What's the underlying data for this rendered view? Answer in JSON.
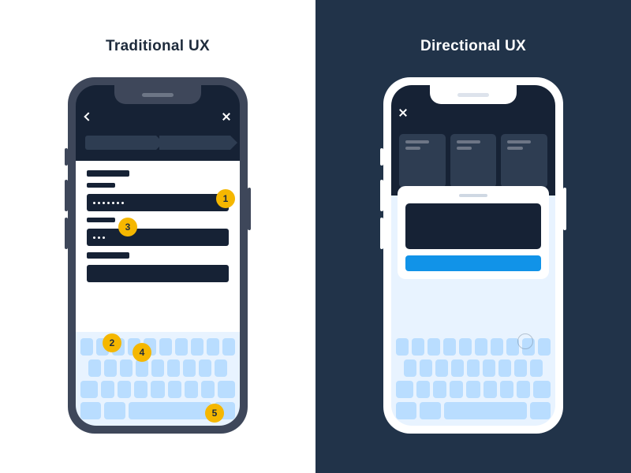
{
  "left": {
    "title": "Traditional UX"
  },
  "right": {
    "title": "Directional UX"
  },
  "badges": {
    "b1": "1",
    "b2": "2",
    "b3": "3",
    "b4": "4",
    "b5": "5"
  },
  "colors": {
    "dark_navy": "#162235",
    "slate": "#213349",
    "yellow": "#f5b700",
    "blue": "#1193e8",
    "key": "#b9ddff",
    "kbd_bg": "#e8f3ff"
  }
}
